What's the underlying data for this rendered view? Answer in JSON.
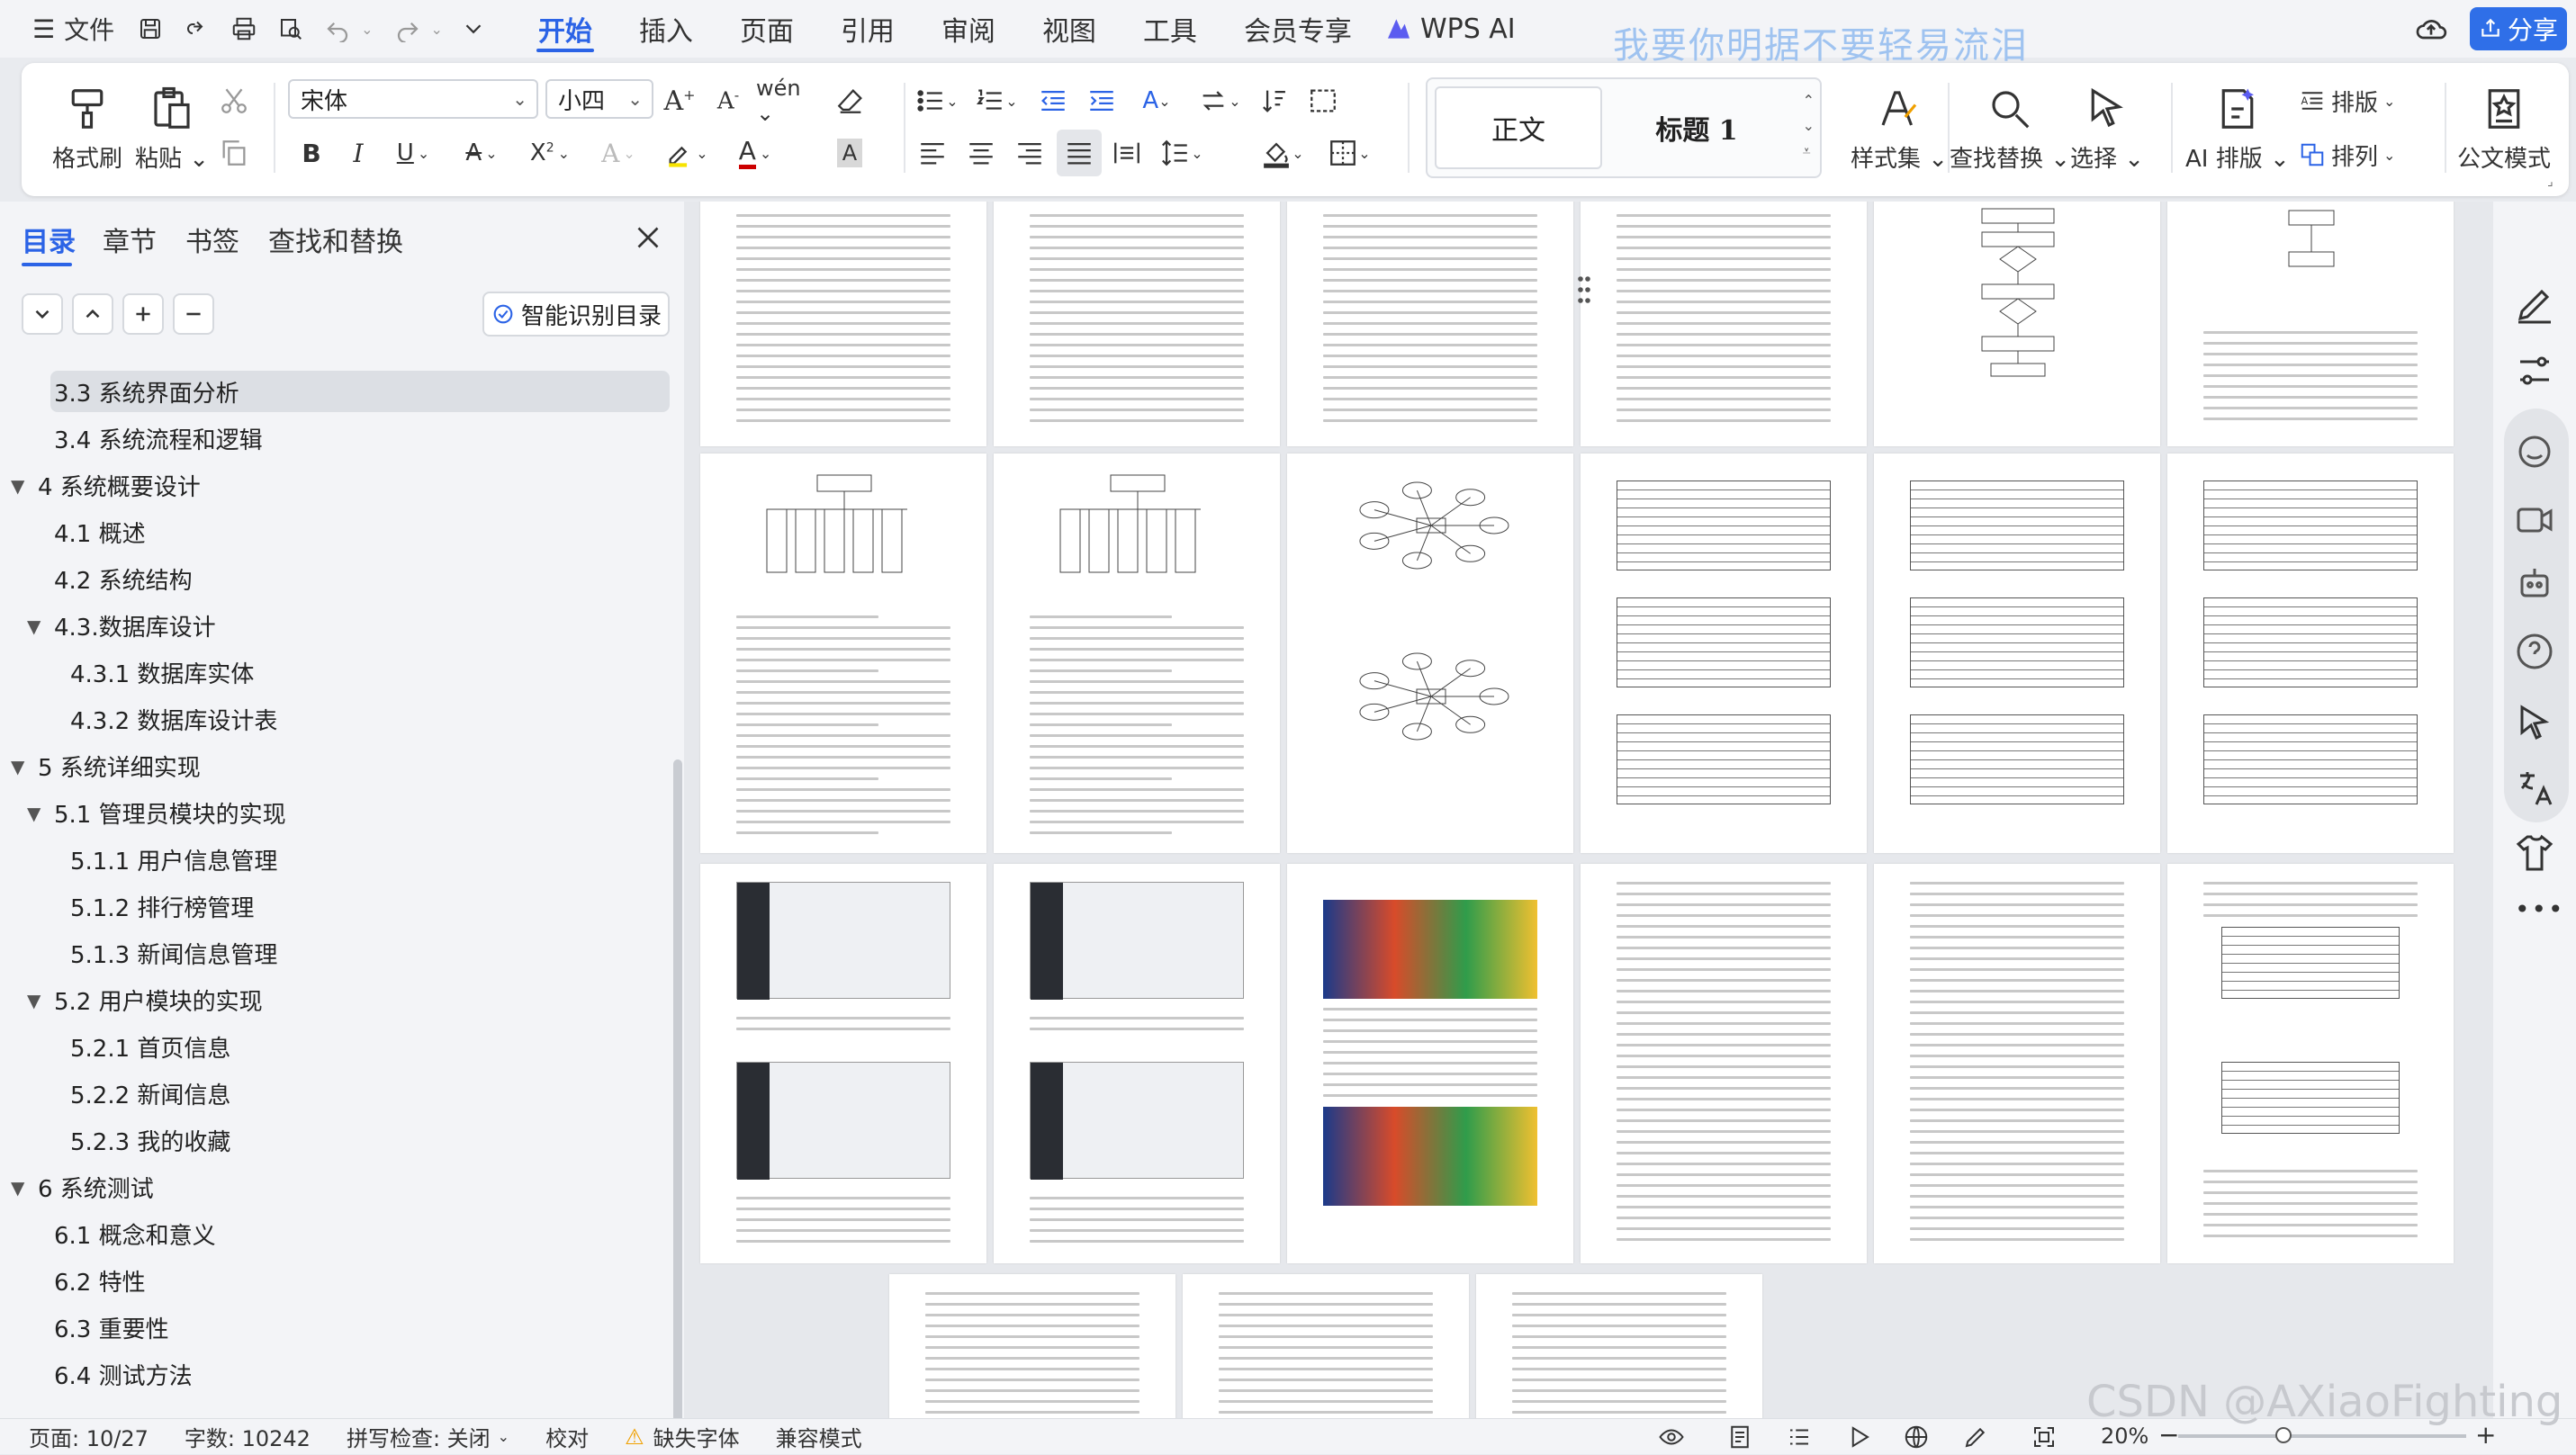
{
  "menubar": {
    "menu_label": "文件",
    "tabs": [
      "开始",
      "插入",
      "页面",
      "引用",
      "审阅",
      "视图",
      "工具",
      "会员专享",
      "WPS AI"
    ],
    "active_tab": "开始",
    "watermark": "我要你明据不要轻易流泪",
    "share_label": "分享"
  },
  "ribbon": {
    "format_painter": "格式刷",
    "paste": "粘贴",
    "font_name": "宋体",
    "font_size": "小四",
    "style_normal": "正文",
    "style_heading": "标题 1",
    "styles": "样式集",
    "find_replace": "查找替换",
    "select": "选择",
    "ai_layout": "AI 排版",
    "layout": "排版",
    "arrange": "排列",
    "doc_mode": "公文模式"
  },
  "nav": {
    "tabs": [
      "目录",
      "章节",
      "书签",
      "查找和替换"
    ],
    "active_tab": "目录",
    "smart_toc": "智能识别目录",
    "toc": [
      {
        "label": "3.3 系统界面分析",
        "level": 2,
        "selected": true
      },
      {
        "label": "3.4 系统流程和逻辑",
        "level": 2
      },
      {
        "label": "4 系统概要设计",
        "level": 1,
        "expanded": true
      },
      {
        "label": "4.1 概述",
        "level": 2
      },
      {
        "label": "4.2 系统结构",
        "level": 2
      },
      {
        "label": "4.3.数据库设计",
        "level": 2,
        "expanded": true
      },
      {
        "label": "4.3.1 数据库实体",
        "level": 3
      },
      {
        "label": "4.3.2 数据库设计表",
        "level": 3
      },
      {
        "label": "5 系统详细实现",
        "level": 1,
        "expanded": true
      },
      {
        "label": "5.1 管理员模块的实现",
        "level": 2,
        "expanded": true
      },
      {
        "label": "5.1.1 用户信息管理",
        "level": 3
      },
      {
        "label": "5.1.2 排行榜管理",
        "level": 3
      },
      {
        "label": "5.1.3 新闻信息管理",
        "level": 3
      },
      {
        "label": "5.2 用户模块的实现",
        "level": 2,
        "expanded": true
      },
      {
        "label": "5.2.1 首页信息",
        "level": 3
      },
      {
        "label": "5.2.2 新闻信息",
        "level": 3
      },
      {
        "label": "5.2.3 我的收藏",
        "level": 3
      },
      {
        "label": "6 系统测试",
        "level": 1,
        "expanded": true
      },
      {
        "label": "6.1 概念和意义",
        "level": 2
      },
      {
        "label": "6.2 特性",
        "level": 2
      },
      {
        "label": "6.3 重要性",
        "level": 2
      },
      {
        "label": "6.4 测试方法",
        "level": 2
      }
    ]
  },
  "status": {
    "page": "页面: 10/27",
    "words": "字数: 10242",
    "spell": "拼写检查: 关闭",
    "proofread": "校对",
    "missing_font": "缺失字体",
    "compat": "兼容模式",
    "zoom": "20%",
    "zoom_level_percent": 20,
    "watermark": "CSDN @AXiaoFighting"
  }
}
